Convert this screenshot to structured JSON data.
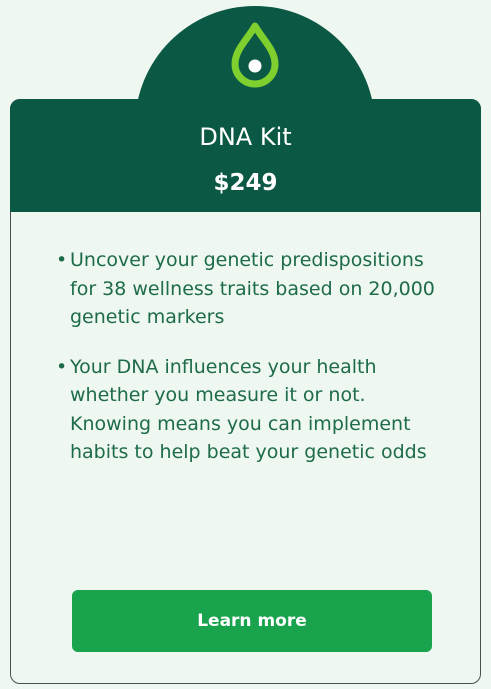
{
  "product": {
    "title": "DNA Kit",
    "price": "$249",
    "logo_icon": "droplet-logo-icon"
  },
  "features": [
    "Uncover your genetic predispositions for 38 wellness traits based on 20,000 genetic markers",
    "Your DNA influences your health whether you measure it or not. Knowing means you can implement habits to help beat your genetic odds"
  ],
  "bullet_glyph": "•",
  "cta": {
    "label": "Learn more"
  },
  "colors": {
    "background": "#eef7f0",
    "header": "#0b5845",
    "feature_text": "#1e6b4c",
    "button": "#19a34d",
    "logo_green": "#7fd02f"
  }
}
